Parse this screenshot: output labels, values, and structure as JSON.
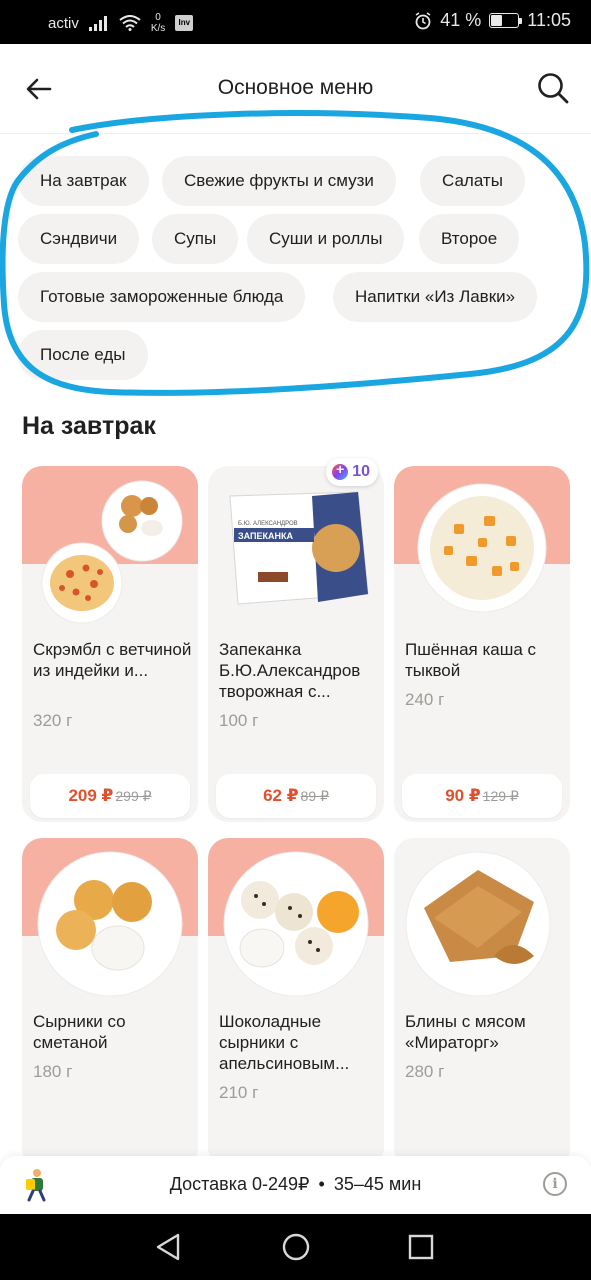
{
  "status_bar": {
    "carrier": "activ",
    "speed_value": "0",
    "speed_unit": "K/s",
    "nfc_label": "Inv",
    "battery_text": "41 %",
    "battery_level": 0.41,
    "time": "11:05"
  },
  "header": {
    "title": "Основное меню"
  },
  "categories": [
    "На завтрак",
    "Свежие фрукты и смузи",
    "Салаты",
    "Сэндвичи",
    "Супы",
    "Суши и роллы",
    "Второе",
    "Готовые замороженные блюда",
    "Напитки «Из Лавки»",
    "После еды"
  ],
  "section": {
    "title": "На завтрак"
  },
  "products": [
    {
      "name": "Скрэмбл с ветчиной из индейки и...",
      "weight": "320 г",
      "price": "209 ₽",
      "old_price": "299 ₽",
      "badge": ""
    },
    {
      "name": "Запеканка Б.Ю.Александров творожная с...",
      "weight": "100 г",
      "price": "62 ₽",
      "old_price": "89 ₽",
      "badge": "10",
      "pack_brand": "Б.Ю. АЛЕКСАНДРОВ",
      "pack_title": "ЗАПЕКАНКА"
    },
    {
      "name": "Пшённая каша с тыквой",
      "weight": "240 г",
      "price": "90 ₽",
      "old_price": "129 ₽",
      "badge": ""
    },
    {
      "name": "Сырники со сметаной",
      "weight": "180 г",
      "price": "",
      "old_price": "",
      "badge": ""
    },
    {
      "name": "Шоколадные сырники с апельсиновым...",
      "weight": "210 г",
      "price": "",
      "old_price": "",
      "badge": ""
    },
    {
      "name": "Блины с мясом «Мираторг»",
      "weight": "280 г",
      "price": "",
      "old_price": "",
      "badge": ""
    }
  ],
  "delivery": {
    "cost": "Доставка 0-249₽",
    "separator": "•",
    "time": "35–45 мин"
  },
  "colors": {
    "accent_price": "#e0502d",
    "chip_bg": "#f3f2f1",
    "card_bg": "#f5f4f2",
    "card_pink": "#f6b1a3",
    "annotation_stroke": "#1aa6e0"
  }
}
